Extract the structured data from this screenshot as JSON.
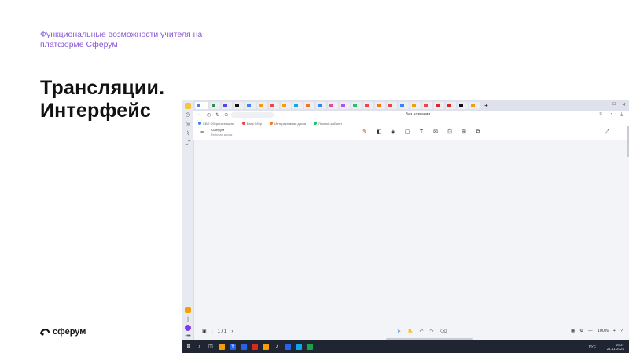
{
  "slide": {
    "subtitle": "Функциональные возможности учителя на платформе Сферум",
    "title_line1": "Трансляции.",
    "title_line2": "Интерфейс",
    "brand": "сферум",
    "brand_color": "#8a5ad6"
  },
  "browser": {
    "tab_count": 27,
    "page_title": "Без названия",
    "bookmarks": [
      {
        "label": "СБП Сберегательная"
      },
      {
        "label": "Банк Сбер"
      },
      {
        "label": "Интерактивная доска"
      },
      {
        "label": "Личный кабинет"
      }
    ],
    "window_controls": [
      "—",
      "□",
      "✕"
    ]
  },
  "app": {
    "board_name": "Сферум",
    "board_sub": "Рабочая доска",
    "tools": [
      "pen-icon",
      "sticky-note-icon",
      "shapes-icon",
      "frame-icon",
      "text-icon",
      "comment-icon",
      "template-icon",
      "table-icon",
      "layers-icon"
    ],
    "page_indicator": "1 / 1",
    "zoom": "100%"
  },
  "taskbar": {
    "lang": "РУС",
    "time": "16:37",
    "date": "21.11.2024"
  }
}
